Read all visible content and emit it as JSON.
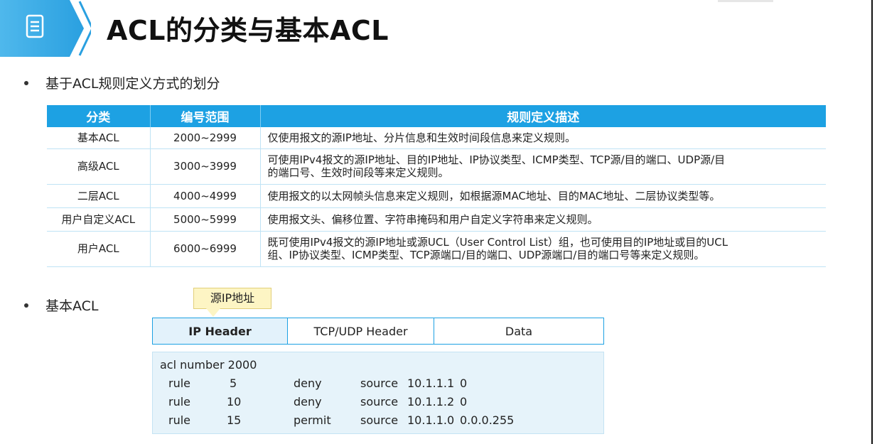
{
  "slide": {
    "title": "ACL的分类与基本ACL",
    "icons": {
      "header": "document-list-icon"
    },
    "colors": {
      "accent": "#1da1e3",
      "callout": "#fdf5c4"
    }
  },
  "bullets": {
    "first": "基于ACL规则定义方式的划分",
    "second": "基本ACL"
  },
  "table": {
    "headers": [
      "分类",
      "编号范围",
      "规则定义描述"
    ],
    "rows": [
      {
        "category": "基本ACL",
        "range": "2000~2999",
        "desc_lines": [
          "仅使用报文的源IP地址、分片信息和生效时间段信息来定义规则。"
        ]
      },
      {
        "category": "高级ACL",
        "range": "3000~3999",
        "desc_lines": [
          "可使用IPv4报文的源IP地址、目的IP地址、IP协议类型、ICMP类型、TCP源/目的端口、UDP源/目",
          "的端口号、生效时间段等来定义规则。"
        ]
      },
      {
        "category": "二层ACL",
        "range": "4000~4999",
        "desc_lines": [
          "使用报文的以太网帧头信息来定义规则，如根据源MAC地址、目的MAC地址、二层协议类型等。"
        ]
      },
      {
        "category": "用户自定义ACL",
        "range": "5000~5999",
        "desc_lines": [
          "使用报文头、偏移位置、字符串掩码和用户自定义字符串来定义规则。"
        ]
      },
      {
        "category": "用户ACL",
        "range": "6000~6999",
        "desc_lines": [
          "既可使用IPv4报文的源IP地址或源UCL（User Control List）组，也可使用目的IP地址或目的UCL",
          "组、IP协议类型、ICMP类型、TCP源端口/目的端口、UDP源端口/目的端口号等来定义规则。"
        ]
      }
    ]
  },
  "callout": "源IP地址",
  "packet": {
    "ip": "IP Header",
    "tcp": "TCP/UDP Header",
    "data": "Data"
  },
  "config": {
    "head": "acl number 2000",
    "rules": [
      {
        "kw": "rule",
        "id": "5",
        "action": "deny",
        "src": "source",
        "addr": "10.1.1.1",
        "wild": "0"
      },
      {
        "kw": "rule",
        "id": "10",
        "action": "deny",
        "src": "source",
        "addr": "10.1.1.2",
        "wild": "0"
      },
      {
        "kw": "rule",
        "id": "15",
        "action": "permit",
        "src": "source",
        "addr": "10.1.1.0",
        "wild": "0.0.0.255"
      }
    ]
  }
}
